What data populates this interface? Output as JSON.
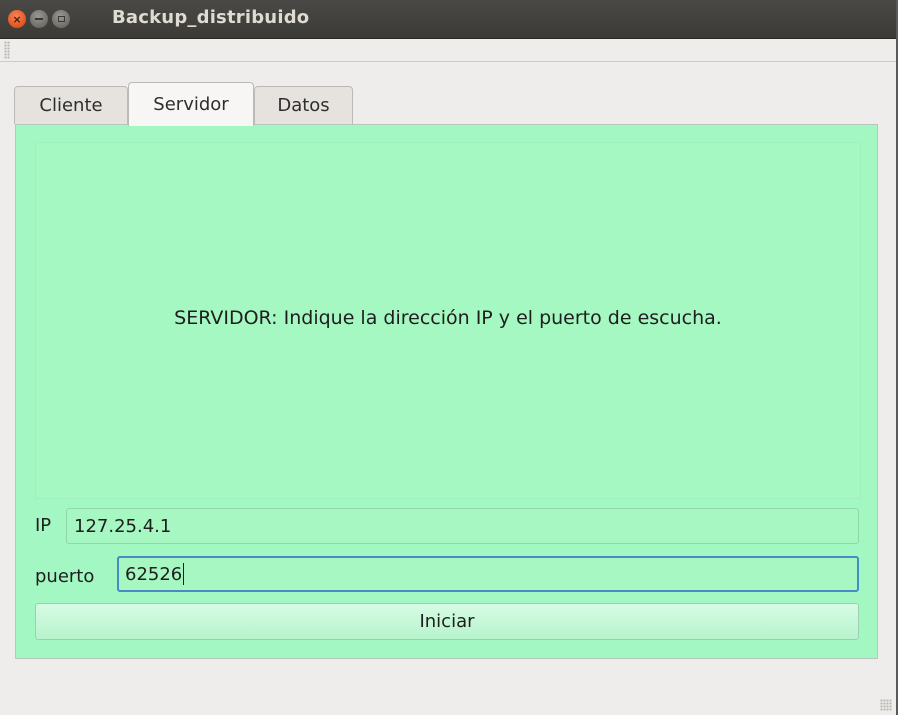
{
  "window": {
    "title": "Backup_distribuido",
    "close_glyph": "×"
  },
  "tabs": [
    {
      "label": "Cliente",
      "active": false
    },
    {
      "label": "Servidor",
      "active": true
    },
    {
      "label": "Datos",
      "active": false
    }
  ],
  "servidor": {
    "info": "SERVIDOR: Indique la dirección IP y el puerto de escucha.",
    "ip_label": "IP",
    "ip_value": "127.25.4.1",
    "port_label": "puerto",
    "port_value": "62526",
    "start_button": "Iniciar"
  },
  "colors": {
    "panel_bg": "#a3f7c3",
    "titlebar_bg": "#3b3a36",
    "close_button": "#e2531e",
    "focus_border": "#4a89c4"
  }
}
